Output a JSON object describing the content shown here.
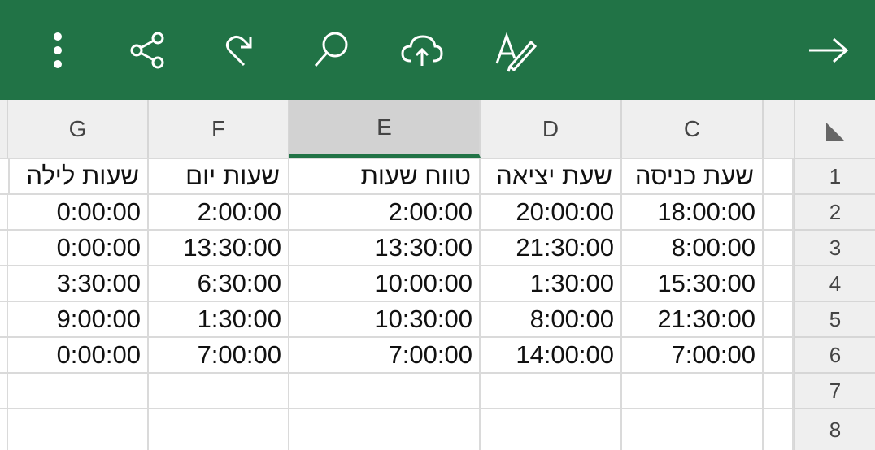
{
  "toolbar": {
    "buttons": [
      {
        "name": "more-options-icon"
      },
      {
        "name": "share-icon"
      },
      {
        "name": "redo-icon"
      },
      {
        "name": "search-icon"
      },
      {
        "name": "cloud-upload-icon"
      },
      {
        "name": "draw-icon"
      },
      {
        "name": "forward-arrow-icon"
      }
    ],
    "bg_color": "#217346"
  },
  "columns": [
    "G",
    "F",
    "E",
    "D",
    "C"
  ],
  "selected_column": "E",
  "rows": [
    "1",
    "2",
    "3",
    "4",
    "5",
    "6",
    "7",
    "8"
  ],
  "cells": {
    "r1": {
      "C": "שעת כניסה",
      "D": "שעת יציאה",
      "E": "טווח שעות",
      "F": "שעות יום",
      "G": "שעות לילה"
    },
    "r2": {
      "C": "18:00:00",
      "D": "20:00:00",
      "E": "2:00:00",
      "F": "2:00:00",
      "G": "0:00:00"
    },
    "r3": {
      "C": "8:00:00",
      "D": "21:30:00",
      "E": "13:30:00",
      "F": "13:30:00",
      "G": "0:00:00"
    },
    "r4": {
      "C": "15:30:00",
      "D": "1:30:00",
      "E": "10:00:00",
      "F": "6:30:00",
      "G": "3:30:00"
    },
    "r5": {
      "C": "21:30:00",
      "D": "8:00:00",
      "E": "10:30:00",
      "F": "1:30:00",
      "G": "9:00:00"
    },
    "r6": {
      "C": "7:00:00",
      "D": "14:00:00",
      "E": "7:00:00",
      "F": "7:00:00",
      "G": "0:00:00"
    }
  }
}
